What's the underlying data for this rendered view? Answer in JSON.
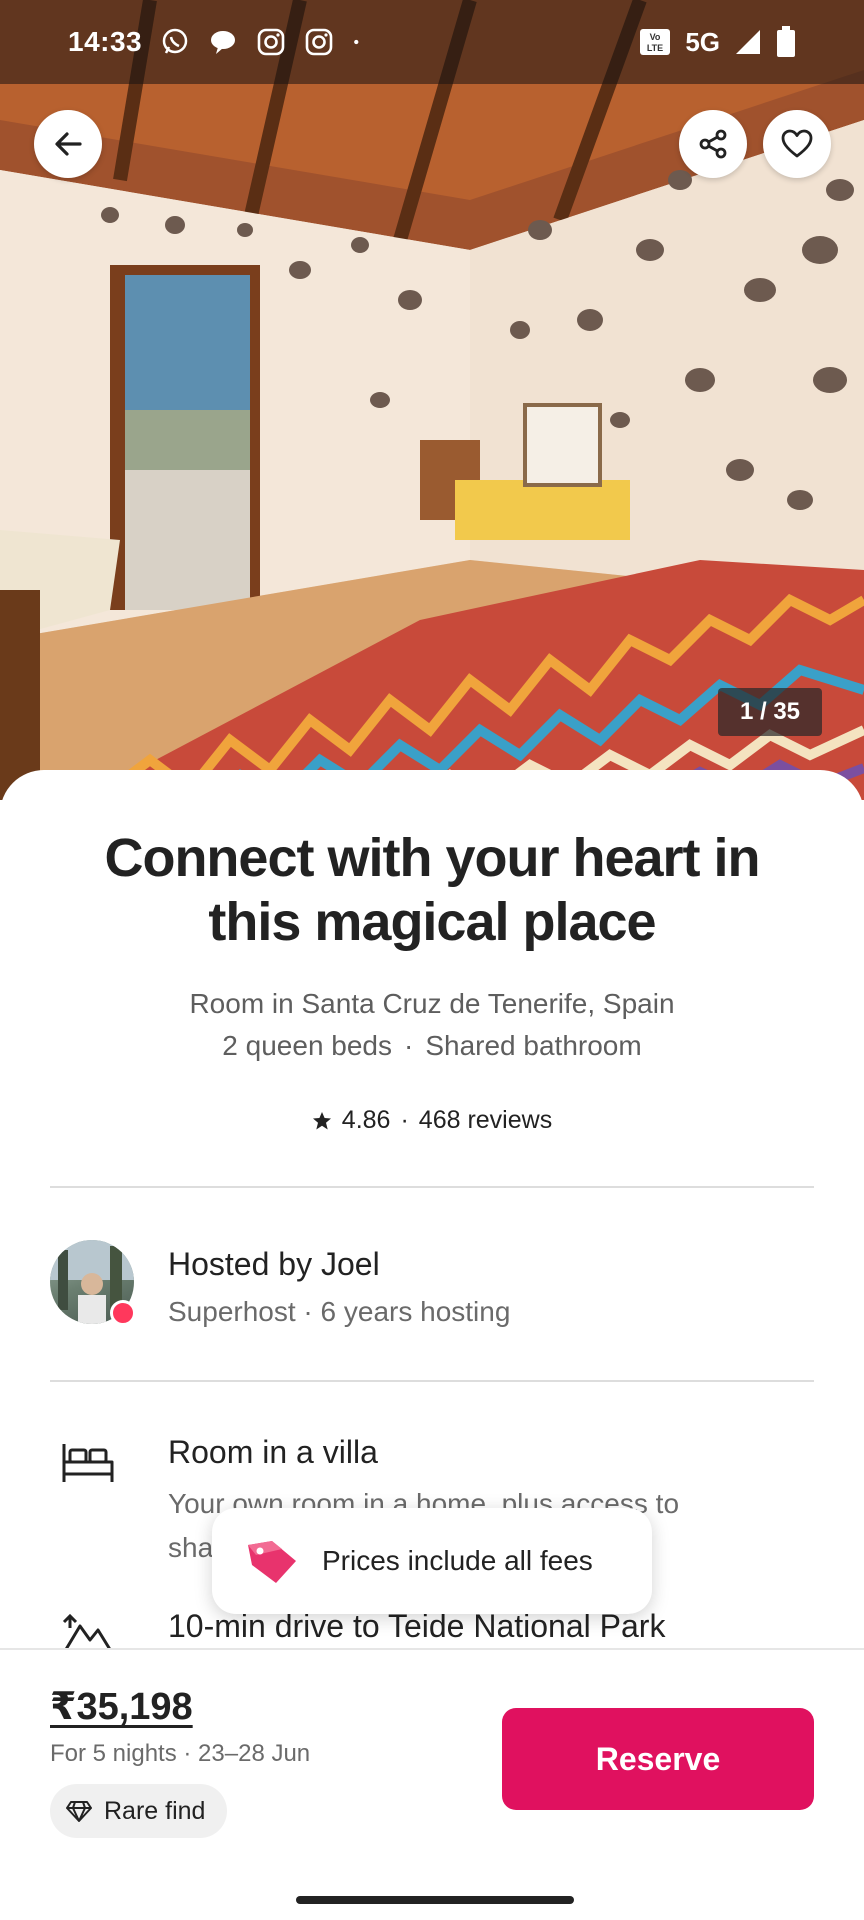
{
  "status_bar": {
    "time": "14:33",
    "network": "5G",
    "left_icons": [
      "whatsapp-icon",
      "chat-icon",
      "instagram-icon",
      "instagram-icon",
      "dot-icon"
    ],
    "right_icons": [
      "volte-icon",
      "signal-icon",
      "battery-icon"
    ]
  },
  "hero": {
    "photo_counter": "1 / 35"
  },
  "listing": {
    "title": "Connect with your heart in this magical place",
    "location": "Room in Santa Cruz de Tenerife, Spain",
    "beds": "2 queen beds",
    "bathroom": "Shared bathroom",
    "rating": "4.86",
    "reviews": "468 reviews"
  },
  "host": {
    "name": "Hosted by Joel",
    "meta": "Superhost · 6 years hosting"
  },
  "features": [
    {
      "title": "Room in a villa",
      "description": "Your own room in a home, plus access to shared spaces."
    },
    {
      "title": "10-min drive to Teide National Park",
      "description": ""
    }
  ],
  "toast": {
    "text": "Prices include all fees"
  },
  "footer": {
    "price": "₹35,198",
    "nights": "For 5 nights · 23–28 Jun",
    "rare_find": "Rare find",
    "reserve_label": "Reserve"
  },
  "colors": {
    "accent": "#e0115f",
    "superhost_badge": "#ff385c",
    "text_primary": "#222222",
    "text_secondary": "#6a6a6a"
  }
}
